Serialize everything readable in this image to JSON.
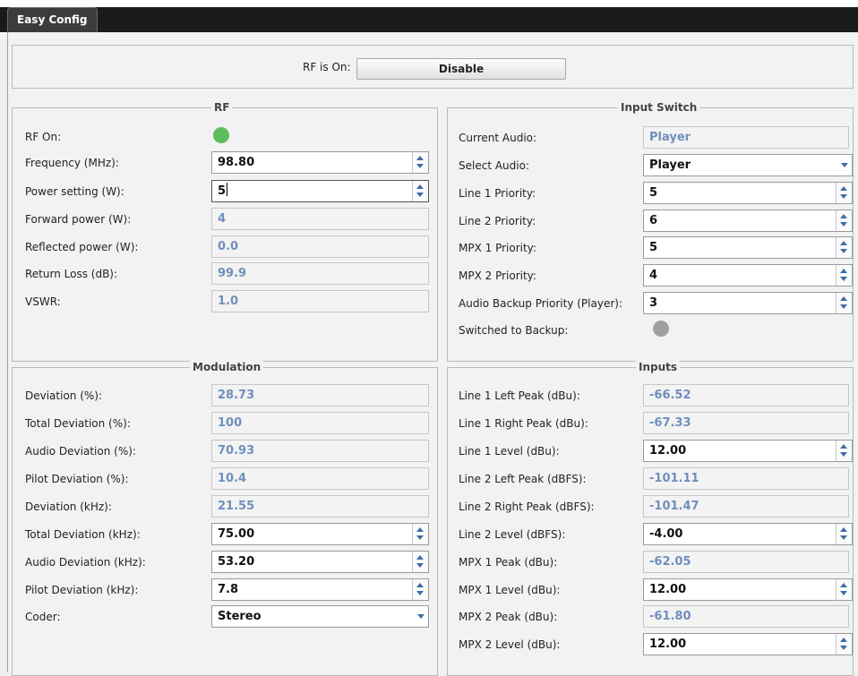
{
  "tab": {
    "label": "Easy Config"
  },
  "top": {
    "rf_label": "RF is On:",
    "button_label": "Disable"
  },
  "rf": {
    "title": "RF",
    "rf_on_label": "RF On:",
    "rf_on_color": "#5cbd5c",
    "frequency": {
      "label": "Frequency (MHz):",
      "value": "98.80"
    },
    "power_setting": {
      "label": "Power setting (W):",
      "value": "5"
    },
    "forward_power": {
      "label": "Forward power (W):",
      "value": "4"
    },
    "reflected_power": {
      "label": "Reflected power (W):",
      "value": "0.0"
    },
    "return_loss": {
      "label": "Return Loss (dB):",
      "value": "99.9"
    },
    "vswr": {
      "label": "VSWR:",
      "value": "1.0"
    }
  },
  "input_switch": {
    "title": "Input Switch",
    "current_audio": {
      "label": "Current Audio:",
      "value": "Player"
    },
    "select_audio": {
      "label": "Select Audio:",
      "value": "Player"
    },
    "line1_priority": {
      "label": "Line 1 Priority:",
      "value": "5"
    },
    "line2_priority": {
      "label": "Line 2 Priority:",
      "value": "6"
    },
    "mpx1_priority": {
      "label": "MPX 1 Priority:",
      "value": "5"
    },
    "mpx2_priority": {
      "label": "MPX 2 Priority:",
      "value": "4"
    },
    "audio_backup_priority": {
      "label": "Audio Backup Priority (Player):",
      "value": "3"
    },
    "switched_to_backup": {
      "label": "Switched to Backup:",
      "color": "#a0a0a0"
    }
  },
  "modulation": {
    "title": "Modulation",
    "deviation_pct": {
      "label": "Deviation (%):",
      "value": "28.73"
    },
    "total_deviation_pct": {
      "label": "Total Deviation (%):",
      "value": "100"
    },
    "audio_deviation_pct": {
      "label": "Audio Deviation (%):",
      "value": "70.93"
    },
    "pilot_deviation_pct": {
      "label": "Pilot Deviation (%):",
      "value": "10.4"
    },
    "deviation_khz": {
      "label": "Deviation (kHz):",
      "value": "21.55"
    },
    "total_deviation_khz": {
      "label": "Total Deviation (kHz):",
      "value": "75.00"
    },
    "audio_deviation_khz": {
      "label": "Audio Deviation (kHz):",
      "value": "53.20"
    },
    "pilot_deviation_khz": {
      "label": "Pilot Deviation (kHz):",
      "value": "7.8"
    },
    "coder": {
      "label": "Coder:",
      "value": "Stereo"
    }
  },
  "inputs": {
    "title": "Inputs",
    "line1_left_peak": {
      "label": "Line 1 Left Peak (dBu):",
      "value": "-66.52"
    },
    "line1_right_peak": {
      "label": "Line 1 Right Peak (dBu):",
      "value": "-67.33"
    },
    "line1_level": {
      "label": "Line 1 Level (dBu):",
      "value": "12.00"
    },
    "line2_left_peak": {
      "label": "Line 2 Left Peak (dBFS):",
      "value": "-101.11"
    },
    "line2_right_peak": {
      "label": "Line 2 Right Peak (dBFS):",
      "value": "-101.47"
    },
    "line2_level": {
      "label": "Line 2 Level (dBFS):",
      "value": "-4.00"
    },
    "mpx1_peak": {
      "label": "MPX 1 Peak (dBu):",
      "value": "-62.05"
    },
    "mpx1_level": {
      "label": "MPX 1 Level (dBu):",
      "value": "12.00"
    },
    "mpx2_peak": {
      "label": "MPX 2 Peak (dBu):",
      "value": "-61.80"
    },
    "mpx2_level": {
      "label": "MPX 2 Level (dBu):",
      "value": "12.00"
    }
  }
}
